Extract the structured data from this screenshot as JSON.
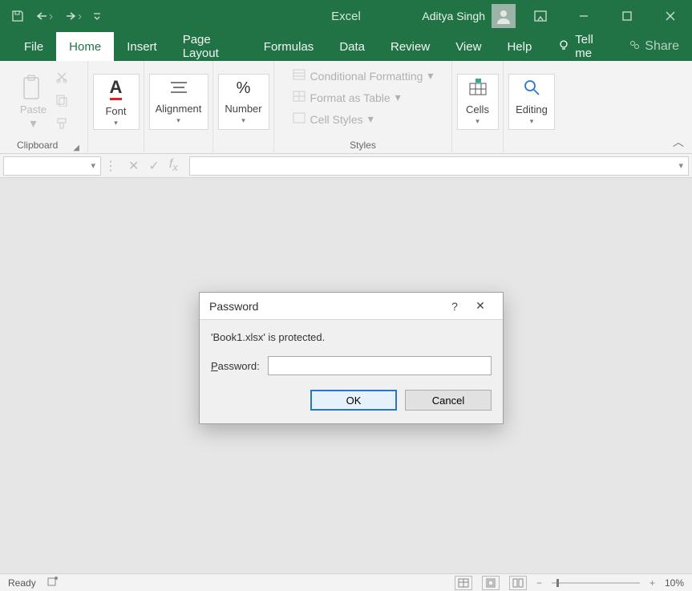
{
  "titlebar": {
    "app_name": "Excel",
    "user_name": "Aditya Singh"
  },
  "tabs": {
    "file": "File",
    "home": "Home",
    "insert": "Insert",
    "page_layout": "Page Layout",
    "formulas": "Formulas",
    "data": "Data",
    "review": "Review",
    "view": "View",
    "help": "Help",
    "tell_me": "Tell me",
    "share": "Share"
  },
  "ribbon": {
    "clipboard": {
      "label": "Clipboard",
      "paste": "Paste"
    },
    "font": {
      "label": "Font"
    },
    "alignment": {
      "label": "Alignment"
    },
    "number": {
      "label": "Number"
    },
    "styles": {
      "label": "Styles",
      "cond_fmt": "Conditional Formatting",
      "format_table": "Format as Table",
      "cell_styles": "Cell Styles"
    },
    "cells": {
      "label": "Cells"
    },
    "editing": {
      "label": "Editing"
    }
  },
  "formula_bar": {
    "namebox": "",
    "formula": ""
  },
  "dialog": {
    "title": "Password",
    "message": "'Book1.xlsx' is protected.",
    "password_label": "Password:",
    "password_value": "",
    "ok": "OK",
    "cancel": "Cancel"
  },
  "statusbar": {
    "left": "Ready",
    "zoom": "10%"
  }
}
